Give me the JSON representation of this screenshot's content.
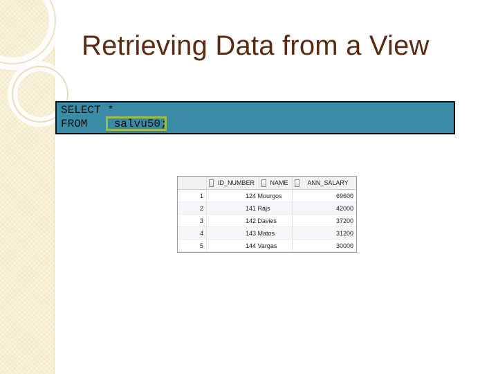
{
  "slide": {
    "title": "Retrieving Data from a View"
  },
  "code": {
    "line1": "SELECT *",
    "line2": "FROM    salvu50;"
  },
  "result_grid": {
    "columns": [
      "ID_NUMBER",
      "NAME",
      "ANN_SALARY"
    ],
    "rows": [
      {
        "row_num": "1",
        "id_name": "124 Mourgos",
        "salary": "69600"
      },
      {
        "row_num": "2",
        "id_name": "141 Rajs",
        "salary": "42000"
      },
      {
        "row_num": "3",
        "id_name": "142 Davies",
        "salary": "37200"
      },
      {
        "row_num": "4",
        "id_name": "143 Matos",
        "salary": "31200"
      },
      {
        "row_num": "5",
        "id_name": "144 Vargas",
        "salary": "30000"
      }
    ]
  }
}
